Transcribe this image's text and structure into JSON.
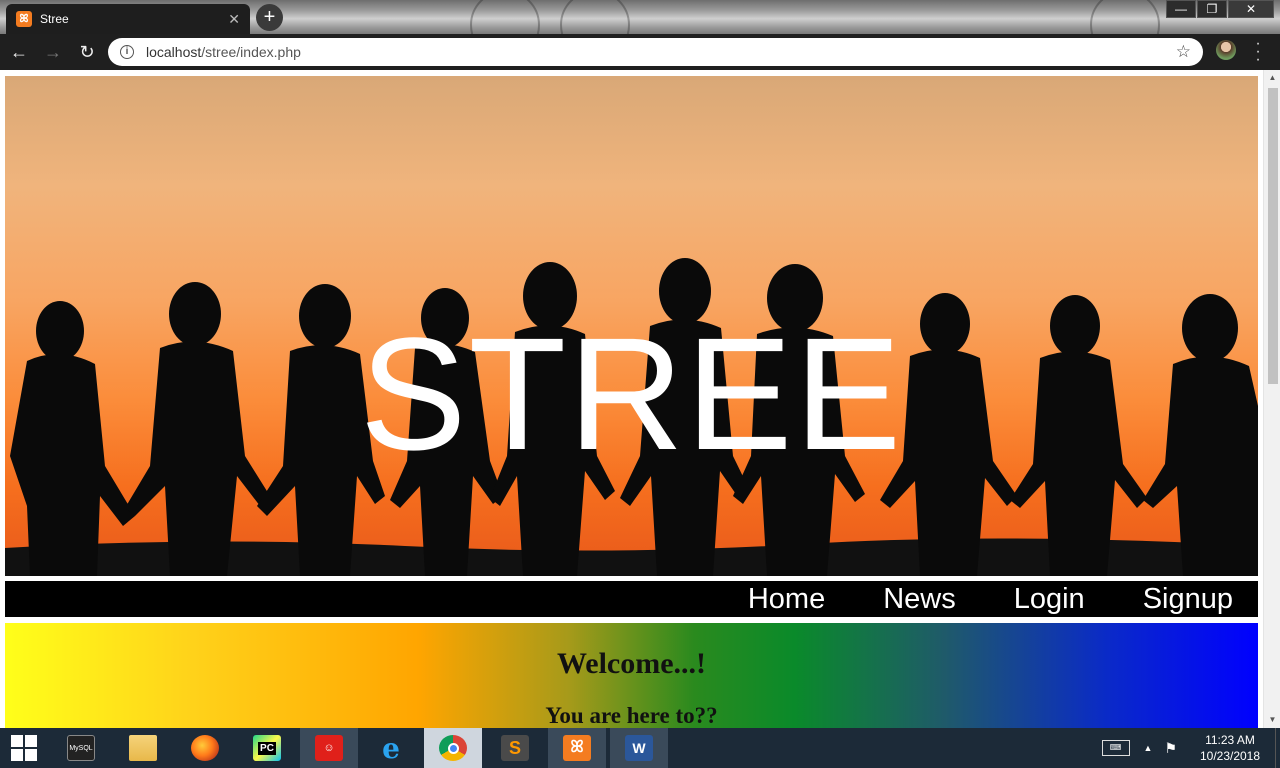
{
  "browser": {
    "tab_title": "Stree",
    "tab_icon": "xampp-icon",
    "url_host": "localhost",
    "url_path": "/stree/index.php",
    "window_controls": [
      "minimize",
      "restore",
      "close"
    ]
  },
  "page": {
    "hero_title": "STREE",
    "nav": [
      {
        "label": "Home"
      },
      {
        "label": "News"
      },
      {
        "label": "Login"
      },
      {
        "label": "Signup"
      }
    ],
    "welcome_heading": "Welcome...!",
    "welcome_subheading": "You are here to??"
  },
  "taskbar": {
    "items": [
      {
        "name": "mysql-workbench",
        "label": "MySQL"
      },
      {
        "name": "file-explorer",
        "label": ""
      },
      {
        "name": "firefox",
        "label": ""
      },
      {
        "name": "pycharm",
        "label": "PC"
      },
      {
        "name": "scratch",
        "label": ""
      },
      {
        "name": "internet-explorer",
        "label": "e"
      },
      {
        "name": "chrome",
        "label": ""
      },
      {
        "name": "sublime-text",
        "label": "S"
      },
      {
        "name": "xampp",
        "label": ""
      },
      {
        "name": "word",
        "label": "W"
      }
    ],
    "clock_time": "11:23 AM",
    "clock_date": "10/23/2018"
  },
  "colors": {
    "hero_sky_top": "#d9a877",
    "hero_sky_bottom": "#e8581a",
    "navbar_bg": "#000000",
    "taskbar_bg": "#1c2a38"
  }
}
